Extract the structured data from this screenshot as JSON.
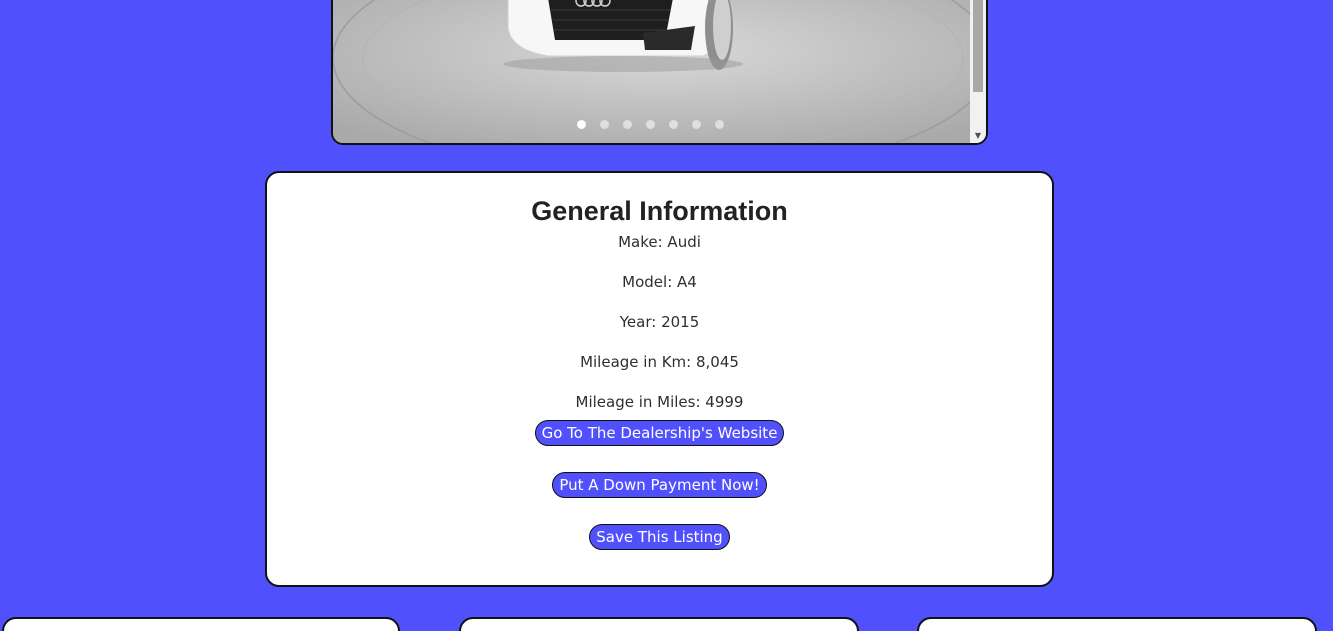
{
  "carousel": {
    "slide_count": 7,
    "active_slide": 1
  },
  "info": {
    "title": "General Information",
    "make": "Make: Audi",
    "model": "Model: A4",
    "year": "Year: 2015",
    "mileage_km": "Mileage in Km: 8,045",
    "mileage_miles": "Mileage in Miles: 4999"
  },
  "actions": {
    "dealership_label": "Go To The Dealership's Website",
    "down_payment_label": "Put A Down Payment Now!",
    "save_label": "Save This Listing"
  },
  "colors": {
    "background": "#5150fd",
    "button": "#5150fd",
    "card": "#ffffff"
  }
}
